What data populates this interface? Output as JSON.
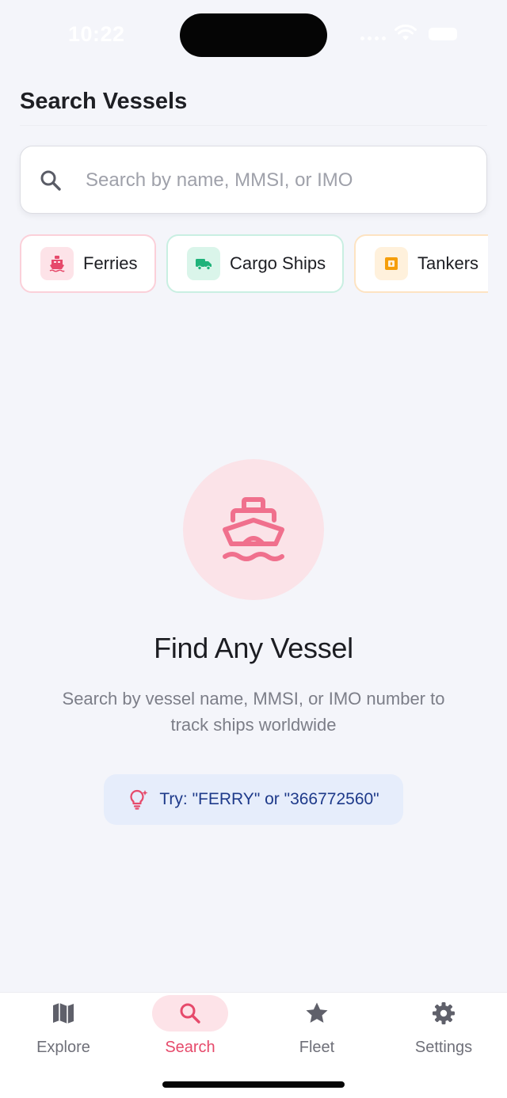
{
  "status_bar": {
    "time": "10:22"
  },
  "header": {
    "title": "Search Vessels"
  },
  "search": {
    "placeholder": "Search by name, MMSI, or IMO",
    "value": ""
  },
  "categories": [
    {
      "label": "Ferries",
      "icon": "ferry-icon",
      "color": "#e64a6b"
    },
    {
      "label": "Cargo Ships",
      "icon": "truck-icon",
      "color": "#1fb37a"
    },
    {
      "label": "Tankers",
      "icon": "tanker-icon",
      "color": "#f59e0b"
    }
  ],
  "empty_state": {
    "icon": "ship-icon",
    "title": "Find Any Vessel",
    "description": "Search by vessel name, MMSI, or IMO number to track ships worldwide",
    "hint": "Try: \"FERRY\" or \"366772560\""
  },
  "tabs": [
    {
      "label": "Explore",
      "icon": "map-icon",
      "active": false
    },
    {
      "label": "Search",
      "icon": "search-icon",
      "active": true
    },
    {
      "label": "Fleet",
      "icon": "star-icon",
      "active": false
    },
    {
      "label": "Settings",
      "icon": "gear-icon",
      "active": false
    }
  ],
  "colors": {
    "accent": "#e64a6b",
    "background": "#f4f5fa",
    "hint_text": "#1e3a8a"
  }
}
